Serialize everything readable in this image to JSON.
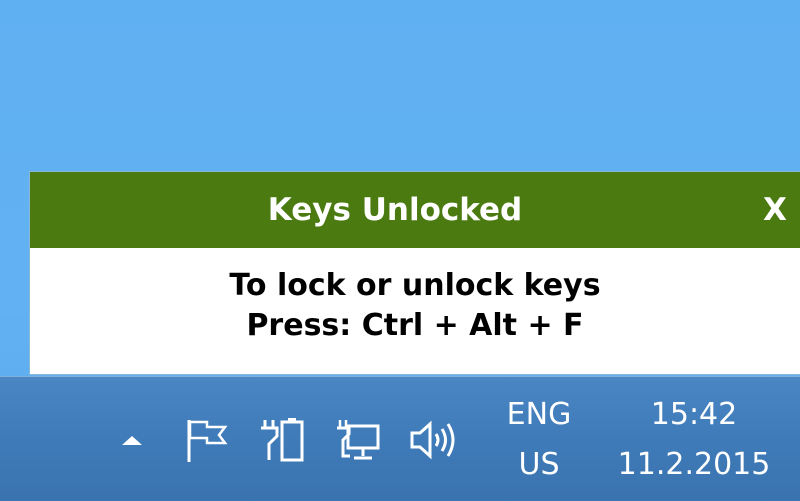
{
  "notification": {
    "title": "Keys Unlocked",
    "close_label": "X",
    "line1": "To lock or unlock keys",
    "line2": "Press: Ctrl + Alt + F",
    "header_color": "#4a7a10"
  },
  "taskbar": {
    "tray_icons": [
      "chevron-up-icon",
      "flag-icon",
      "power-icon",
      "network-icon",
      "volume-icon"
    ],
    "language": {
      "code": "ENG",
      "layout": "US"
    },
    "clock": {
      "time": "15:42",
      "date": "11.2.2015"
    }
  }
}
